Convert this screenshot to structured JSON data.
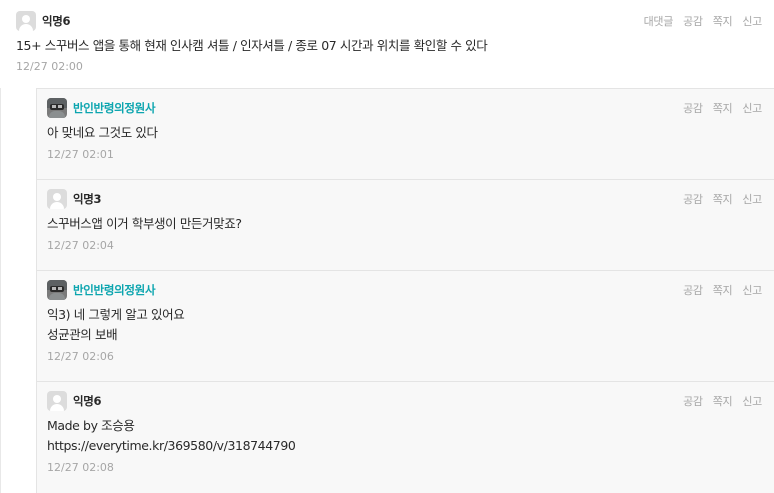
{
  "comment": {
    "nickname": "익명6",
    "actions": [
      "대댓글",
      "공감",
      "쪽지",
      "신고"
    ],
    "text": "15+ 스꾸버스 앱을 통해 현재 인사캠 셔틀 / 인자셔틀 / 종로 07 시간과 위치를 확인할 수 있다",
    "time": "12/27 02:00"
  },
  "replies": [
    {
      "nickname": "반인반령의정원사",
      "avatar": "photo",
      "is_writer": true,
      "actions": [
        "공감",
        "쪽지",
        "신고"
      ],
      "lines": [
        "아 맞네요 그것도 있다"
      ],
      "time": "12/27 02:01"
    },
    {
      "nickname": "익명3",
      "avatar": "anonymous",
      "is_writer": false,
      "actions": [
        "공감",
        "쪽지",
        "신고"
      ],
      "lines": [
        "스꾸버스앱 이거 학부생이 만든거맞죠?"
      ],
      "time": "12/27 02:04"
    },
    {
      "nickname": "반인반령의정원사",
      "avatar": "photo",
      "is_writer": true,
      "actions": [
        "공감",
        "쪽지",
        "신고"
      ],
      "lines": [
        "익3) 네 그렇게 알고 있어요",
        "성균관의 보배"
      ],
      "time": "12/27 02:06"
    },
    {
      "nickname": "익명6",
      "avatar": "anonymous",
      "is_writer": false,
      "actions": [
        "공감",
        "쪽지",
        "신고"
      ],
      "lines": [
        "Made by 조승용",
        "https://everytime.kr/369580/v/318744790"
      ],
      "time": "12/27 02:08"
    }
  ],
  "colors": {
    "writer_nickname": "#0ca5af",
    "reply_background": "#f8f8f8",
    "muted_text": "#a6a6a6"
  }
}
